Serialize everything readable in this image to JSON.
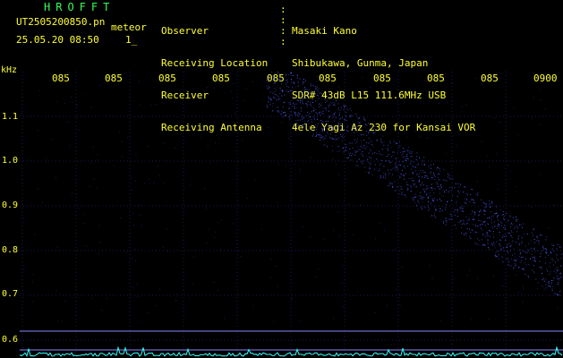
{
  "header": {
    "logo": "HROFFT",
    "filename": "UT2505200850.pn",
    "tag": "meteor",
    "datetime": "25.05.20 08:50",
    "marker": "1_",
    "fields": [
      {
        "label": "Observer",
        "value": "Masaki Kano"
      },
      {
        "label": "Receiving Location",
        "value": "Shibukawa, Gunma, Japan"
      },
      {
        "label": "Receiver",
        "value": "SDR# 43dB L15 111.6MHz USB"
      },
      {
        "label": "Receiving Antenna",
        "value": "4ele Yagi Az 230 for Kansai VOR"
      }
    ]
  },
  "spectrogram": {
    "y_unit": "kHz",
    "y_ticks": [
      "1.1",
      "1.0",
      "0.9",
      "0.8",
      "0.7",
      "0.6"
    ],
    "x_ticks": [
      "085",
      "085",
      "085",
      "085",
      "085",
      "085",
      "085",
      "085",
      "085",
      "0900"
    ],
    "colors": {
      "text": "#ffff33",
      "logo": "#33ff55",
      "signal": "#4f5cff",
      "grid": "#1a1a55",
      "noise": "#33ffff"
    }
  }
}
